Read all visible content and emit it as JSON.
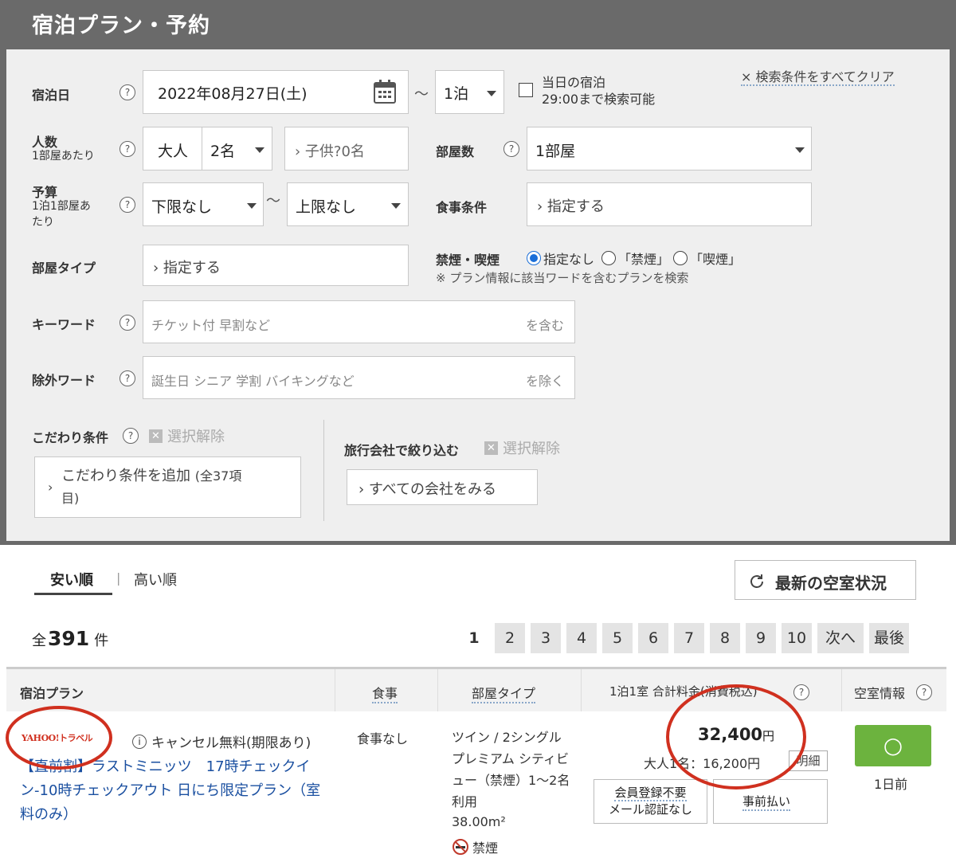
{
  "header": {
    "title": "宿泊プラン・予約"
  },
  "search": {
    "clear_all": "× 検索条件をすべてクリア",
    "checkin": {
      "label": "宿泊日",
      "help": "?",
      "date": "2022年08月27日(土)",
      "tilde": "〜",
      "nights": "1泊",
      "sameday_line1": "当日の宿泊",
      "sameday_line2": "29:00まで検索可能"
    },
    "people": {
      "label": "人数",
      "sub": "1部屋あたり",
      "help": "?",
      "adult_label": "大人",
      "adult_value": "2名",
      "child": "› 子供?0名"
    },
    "rooms": {
      "label": "部屋数",
      "help": "?",
      "value": "1部屋"
    },
    "budget": {
      "label": "予算",
      "sub1": "1泊1部屋あ",
      "sub2": "たり",
      "help": "?",
      "min": "下限なし",
      "tilde": "〜",
      "max": "上限なし"
    },
    "meal": {
      "label": "食事条件",
      "value": "› 指定する"
    },
    "roomtype": {
      "label": "部屋タイプ",
      "value": "› 指定する"
    },
    "smoking": {
      "label": "禁煙・喫煙",
      "opt1": "指定なし",
      "opt2": "「禁煙」",
      "opt3": "「喫煙」",
      "note": "※ プラン情報に該当ワードを含むプランを検索"
    },
    "keyword": {
      "label": "キーワード",
      "help": "?",
      "placeholder": "チケット付 早割など",
      "suffix": "を含む"
    },
    "exclude": {
      "label": "除外ワード",
      "help": "?",
      "placeholder": "誕生日 シニア 学割 バイキングなど",
      "suffix": "を除く"
    },
    "kodawari": {
      "label": "こだわり条件",
      "help": "?",
      "clear": "選択解除",
      "add_line1": "こだわり条件を追加",
      "add_count": "(全37項",
      "add_line2": "目)"
    },
    "agency": {
      "label": "旅行会社で絞り込む",
      "clear": "選択解除",
      "all": "› すべての会社をみる"
    }
  },
  "results": {
    "sort_cheap": "安い順",
    "sort_sep": "|",
    "sort_expensive": "高い順",
    "refresh": "最新の空室状況",
    "total_prefix": "全",
    "total_count": "391",
    "total_suffix": "件",
    "pages": [
      "1",
      "2",
      "3",
      "4",
      "5",
      "6",
      "7",
      "8",
      "9",
      "10"
    ],
    "next": "次へ",
    "last": "最後",
    "columns": {
      "plan": "宿泊プラン",
      "meal": "食事",
      "roomtype": "部屋タイプ",
      "price": "1泊1室 合計料金(消費税込)",
      "price_help": "?",
      "vacancy": "空室情報",
      "vacancy_help": "?"
    }
  },
  "plan": {
    "provider_logo": "YAHOO!トラベル",
    "cancel_note": "キャンセル無料(期限あり)",
    "title": "【直前割】ラストミニッツ　17時チェックイン-10時チェックアウト 日にち限定プラン（室料のみ）",
    "meal": "食事なし",
    "room_desc": "ツイン / 2シングル プレミアム シティビュー（禁煙）1〜2名利用",
    "room_size": "38.00m²",
    "room_smoking": "禁煙",
    "price": "32,400",
    "price_unit": "円",
    "per_person": "大人1名：16,200円",
    "detail": "明細",
    "member_line1": "会員登録不要",
    "member_line2": "メール認証なし",
    "prepay": "事前払い",
    "vacancy_mark": "○",
    "vacancy_note": "1日前"
  },
  "colors": {
    "header": "#6a6a6a",
    "panel": "#efefef",
    "link": "#1a4fa0",
    "vacancy": "#6cb33e",
    "annotation": "#d0301f"
  }
}
